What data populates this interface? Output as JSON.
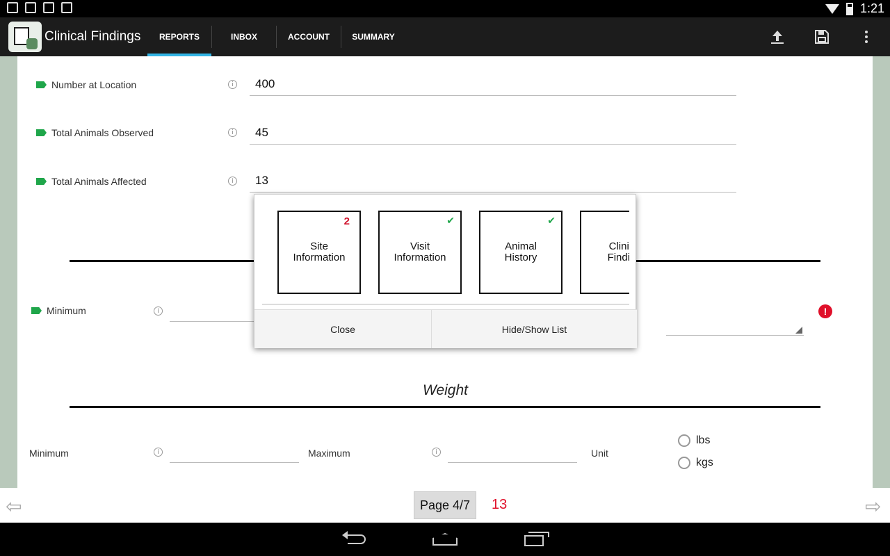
{
  "status_bar": {
    "time": "1:21",
    "icons": [
      "image-icon",
      "download-icon",
      "briefcase-icon",
      "briefcase-icon"
    ]
  },
  "app_bar": {
    "title": "Clinical Findings",
    "tabs": [
      {
        "label": "REPORTS",
        "active": true
      },
      {
        "label": "INBOX",
        "active": false
      },
      {
        "label": "ACCOUNT",
        "active": false
      },
      {
        "label": "SUMMARY",
        "active": false
      }
    ],
    "actions": [
      "upload-icon",
      "save-icon",
      "overflow-menu-icon"
    ]
  },
  "form": {
    "fields": [
      {
        "label": "Number at Location",
        "value": "400"
      },
      {
        "label": "Total Animals Observed",
        "value": "45"
      },
      {
        "label": "Total Animals Affected",
        "value": "13"
      }
    ],
    "section1": {
      "min_label": "Minimum"
    },
    "weight_section": {
      "title": "Weight",
      "min_label": "Minimum",
      "max_label": "Maximum",
      "unit_label": "Unit",
      "unit_options": [
        "lbs",
        "kgs"
      ]
    }
  },
  "popup": {
    "cards": [
      {
        "line1": "Site",
        "line2": "Information",
        "badge": "2",
        "check": false
      },
      {
        "line1": "Visit",
        "line2": "Information",
        "badge": "",
        "check": true
      },
      {
        "line1": "Animal",
        "line2": "History",
        "badge": "",
        "check": true
      },
      {
        "line1": "Clinic",
        "line2": "Findin",
        "badge": "",
        "check": false
      }
    ],
    "close_label": "Close",
    "toggle_label": "Hide/Show List"
  },
  "pager": {
    "page_label": "Page 4/7",
    "count": "13"
  },
  "colors": {
    "accent": "#33b5e5",
    "tag_green": "#1fa64a",
    "error_red": "#e0102a"
  }
}
